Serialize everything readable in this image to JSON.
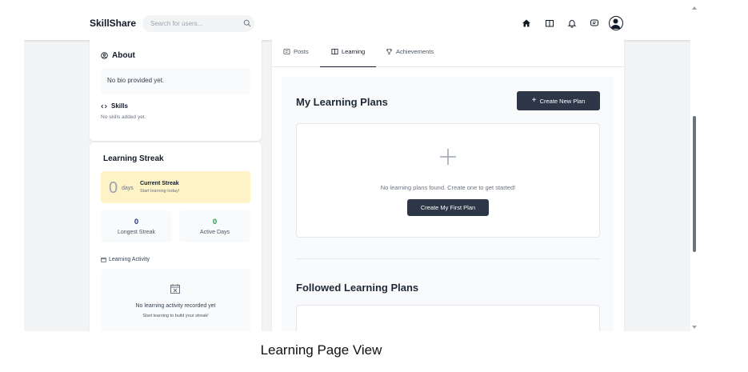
{
  "navbar": {
    "brand": "SkillShare",
    "search_placeholder": "Search for users..."
  },
  "about": {
    "title": "About",
    "bio": "No bio provided yet.",
    "skills_title": "Skills",
    "skills_text": "No skills added yet."
  },
  "streak": {
    "title": "Learning Streak",
    "current_days": "0",
    "days_label": "days",
    "current_title": "Current Streak",
    "current_sub": "Start learning today!",
    "longest_value": "0",
    "longest_label": "Longest Streak",
    "active_value": "0",
    "active_label": "Active Days",
    "activity_title": "Learning Activity",
    "activity_empty": "No learning activity recorded yet",
    "activity_sub": "Start learning to build your streak!"
  },
  "tabs": [
    {
      "label": "Posts"
    },
    {
      "label": "Learning"
    },
    {
      "label": "Achievements"
    }
  ],
  "learning": {
    "my_plans_title": "My Learning Plans",
    "create_button": "Create New Plan",
    "empty_text": "No learning plans found. Create one to get started!",
    "first_plan_button": "Create My First Plan",
    "followed_title": "Followed Learning Plans"
  },
  "caption": "Learning Page View",
  "colors": {
    "accent_dark": "#2d3748",
    "streak_bg": "#fef3c7",
    "longest_color": "#1e3a8a",
    "active_color": "#16a34a"
  }
}
